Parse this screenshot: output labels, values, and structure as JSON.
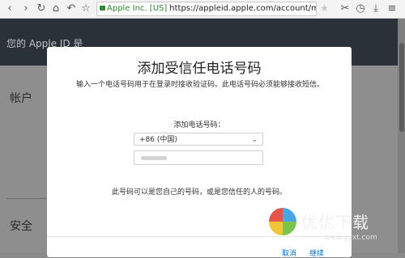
{
  "browser": {
    "security_label": "Apple Inc. [US]",
    "url": "https://appleid.apple.com/account/manage",
    "icons": [
      "back-icon",
      "forward-icon",
      "reload-icon",
      "home-icon",
      "undo-icon",
      "star-icon"
    ]
  },
  "page": {
    "hero_text": "您的 Apple ID 是",
    "sections": [
      "帐户",
      "安全"
    ]
  },
  "modal": {
    "title": "添加受信任电话号码",
    "description": "输入一个电话号码用于在登录时接收验证码。此电话号码必须能够接收短信。",
    "phone_label": "添加电话号码：",
    "country_value": "+86 (中国)",
    "note": "此号码可以是您自己的号码，或是您信任的人的号码。",
    "footer_buttons": [
      "取消",
      "继续"
    ]
  },
  "watermark": {
    "text": "优优下载",
    "url": "www.yyxt.com"
  }
}
